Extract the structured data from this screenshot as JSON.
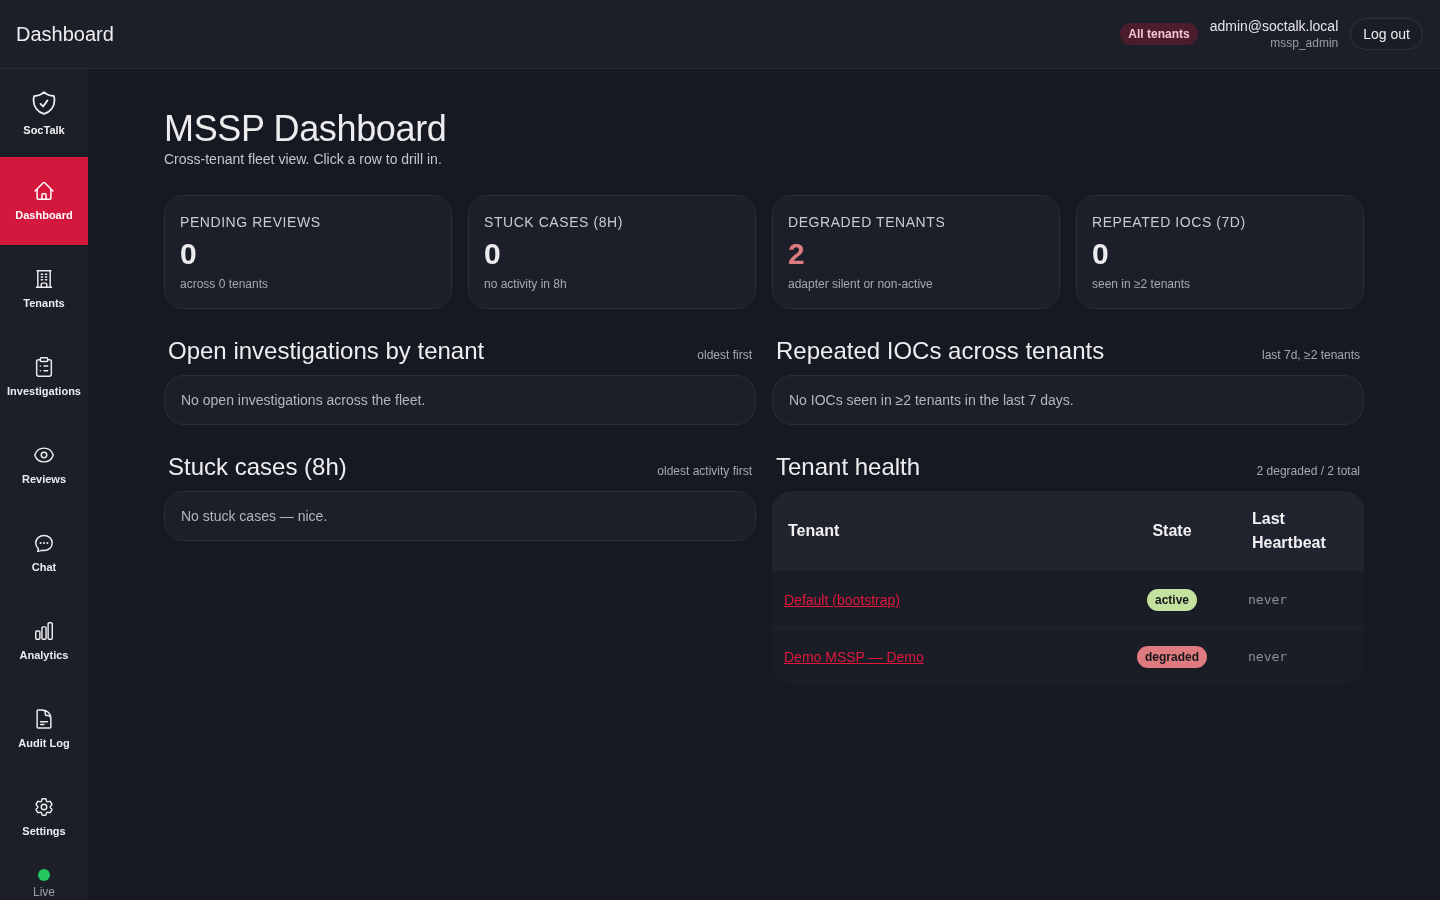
{
  "header": {
    "title": "Dashboard",
    "scope_badge": "All tenants",
    "user": {
      "email": "admin@soctalk.local",
      "role": "mssp_admin"
    },
    "logout": "Log out"
  },
  "sidebar": {
    "brand": "SocTalk",
    "items": [
      {
        "label": "Dashboard",
        "selected": true
      },
      {
        "label": "Tenants",
        "selected": false
      },
      {
        "label": "Investigations",
        "selected": false
      },
      {
        "label": "Reviews",
        "selected": false
      },
      {
        "label": "Chat",
        "selected": false
      },
      {
        "label": "Analytics",
        "selected": false
      },
      {
        "label": "Audit Log",
        "selected": false
      },
      {
        "label": "Settings",
        "selected": false
      }
    ],
    "status": {
      "label": "Live",
      "connected": true
    }
  },
  "page": {
    "title": "MSSP Dashboard",
    "subtitle": "Cross-tenant fleet view. Click a row to drill in."
  },
  "stats": [
    {
      "label": "PENDING REVIEWS",
      "value": "0",
      "note": "across 0 tenants",
      "alert": false
    },
    {
      "label": "STUCK CASES (8H)",
      "value": "0",
      "note": "no activity in 8h",
      "alert": false
    },
    {
      "label": "DEGRADED TENANTS",
      "value": "2",
      "note": "adapter silent or non-active",
      "alert": true
    },
    {
      "label": "REPEATED IOCS (7D)",
      "value": "0",
      "note": "seen in ≥2 tenants",
      "alert": false
    }
  ],
  "open_investigations": {
    "title": "Open investigations by tenant",
    "hint": "oldest first",
    "empty_message": "No open investigations across the fleet."
  },
  "stuck_cases": {
    "title": "Stuck cases (8h)",
    "hint": "oldest activity first",
    "empty_message": "No stuck cases — nice."
  },
  "repeated_iocs": {
    "title": "Repeated IOCs across tenants",
    "hint": "last 7d, ≥2 tenants",
    "empty_message": "No IOCs seen in ≥2 tenants in the last 7 days."
  },
  "tenant_health": {
    "title": "Tenant health",
    "hint": "2 degraded / 2 total",
    "columns": [
      "Tenant",
      "State",
      "Last Heartbeat"
    ],
    "rows": [
      {
        "tenant": "Default (bootstrap)",
        "state": "active",
        "color": "#c3e29e",
        "last_heartbeat": "never"
      },
      {
        "tenant": "Demo MSSP — Demo",
        "state": "degraded",
        "color": "#df7b7e",
        "last_heartbeat": "never"
      }
    ]
  }
}
